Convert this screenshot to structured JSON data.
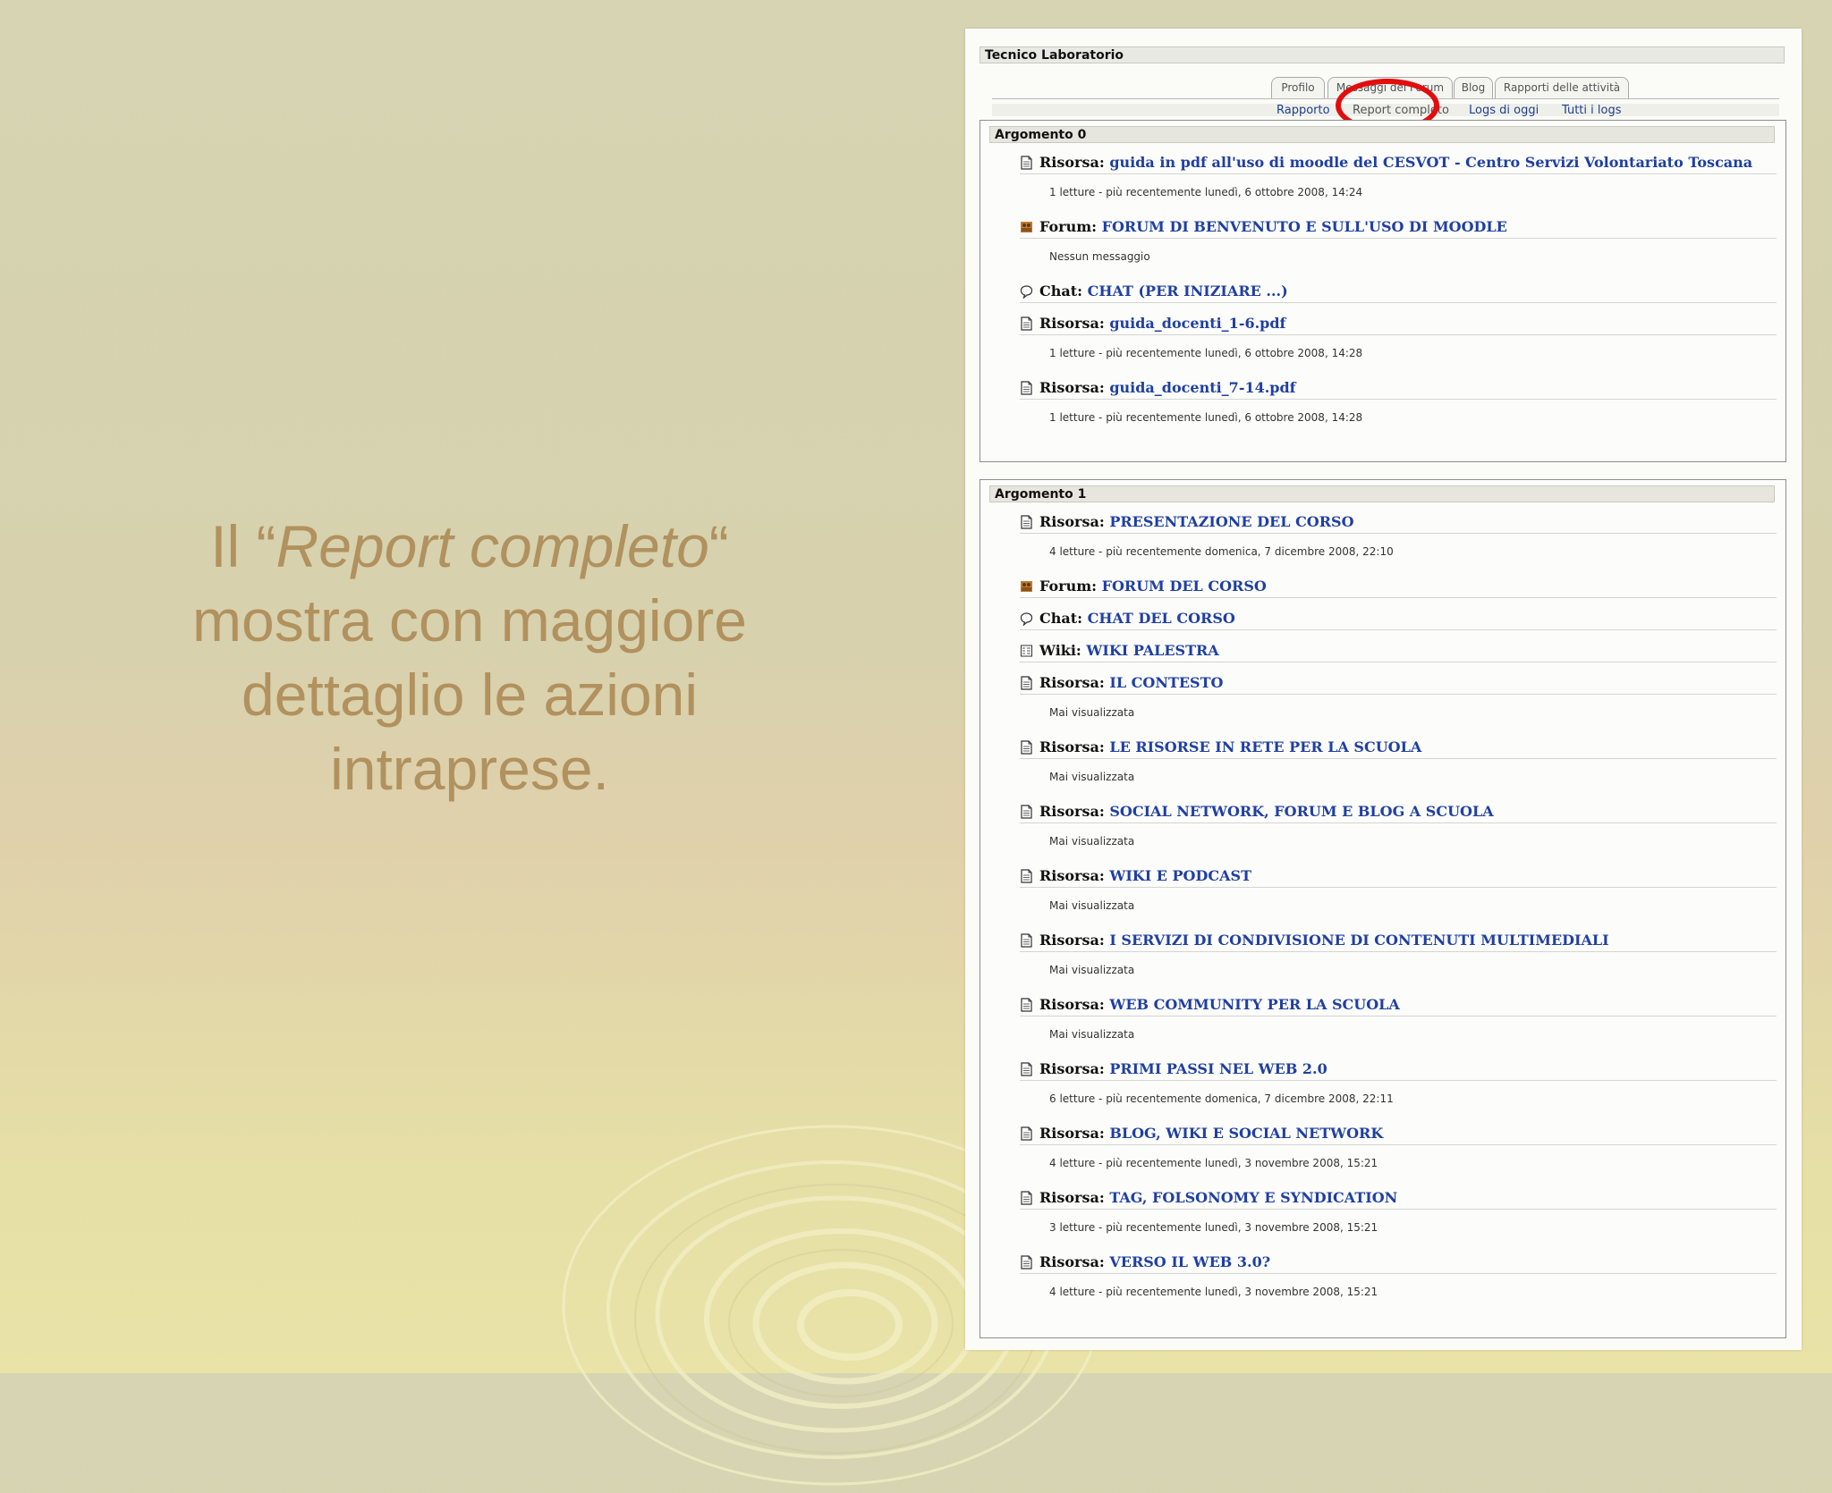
{
  "caption": {
    "line1_pre": "Il “",
    "line1_em": "Report completo",
    "line1_post": "“",
    "line2": "mostra con maggiore",
    "line3": "dettaglio le azioni",
    "line4": "intraprese."
  },
  "course": {
    "title": "Tecnico Laboratorio"
  },
  "tabs": [
    {
      "label": "Profilo"
    },
    {
      "label": "Messaggi del Forum"
    },
    {
      "label": "Blog"
    },
    {
      "label": "Rapporti delle attività"
    }
  ],
  "subtabs": [
    {
      "label": "Rapporto"
    },
    {
      "label": "Report completo",
      "active": true
    },
    {
      "label": "Logs di oggi"
    },
    {
      "label": "Tutti i logs"
    }
  ],
  "colors": {
    "link": "#1f3fa3",
    "highlight_ring": "#e20d0d",
    "caption": "#b1915e"
  },
  "sections": [
    {
      "title": "Argomento 0",
      "items": [
        {
          "icon": "resource-icon",
          "type": "Risorsa:",
          "name": "guida in pdf all'uso di moodle del CESVOT - Centro Servizi Volontariato Toscana",
          "detail": "1 letture - più recentemente lunedì, 6 ottobre 2008, 14:24"
        },
        {
          "icon": "forum-icon",
          "type": "Forum:",
          "name": "FORUM DI BENVENUTO E SULL'USO DI MOODLE",
          "detail": "Nessun messaggio"
        },
        {
          "icon": "chat-icon",
          "type": "Chat:",
          "name": "CHAT (PER INIZIARE ...)",
          "detail": ""
        },
        {
          "icon": "resource-icon",
          "type": "Risorsa:",
          "name": "guida_docenti_1-6.pdf",
          "detail": "1 letture - più recentemente lunedì, 6 ottobre 2008, 14:28"
        },
        {
          "icon": "resource-icon",
          "type": "Risorsa:",
          "name": "guida_docenti_7-14.pdf",
          "detail": "1 letture - più recentemente lunedì, 6 ottobre 2008, 14:28"
        }
      ]
    },
    {
      "title": "Argomento 1",
      "items": [
        {
          "icon": "resource-icon",
          "type": "Risorsa:",
          "name": "PRESENTAZIONE DEL CORSO",
          "detail": "4 letture - più recentemente domenica, 7 dicembre 2008, 22:10"
        },
        {
          "icon": "forum-icon",
          "type": "Forum:",
          "name": "FORUM DEL CORSO",
          "detail": ""
        },
        {
          "icon": "chat-icon",
          "type": "Chat:",
          "name": "CHAT DEL CORSO",
          "detail": ""
        },
        {
          "icon": "wiki-icon",
          "type": "Wiki:",
          "name": "WIKI PALESTRA",
          "detail": ""
        },
        {
          "icon": "resource-icon",
          "type": "Risorsa:",
          "name": "IL CONTESTO",
          "detail": "Mai visualizzata"
        },
        {
          "icon": "resource-icon",
          "type": "Risorsa:",
          "name": "LE RISORSE IN RETE PER LA SCUOLA",
          "detail": "Mai visualizzata"
        },
        {
          "icon": "resource-icon",
          "type": "Risorsa:",
          "name": "SOCIAL NETWORK, FORUM E BLOG A SCUOLA",
          "detail": "Mai visualizzata"
        },
        {
          "icon": "resource-icon",
          "type": "Risorsa:",
          "name": "WIKI E PODCAST",
          "detail": "Mai visualizzata"
        },
        {
          "icon": "resource-icon",
          "type": "Risorsa:",
          "name": "I SERVIZI DI CONDIVISIONE DI CONTENUTI MULTIMEDIALI",
          "detail": "Mai visualizzata"
        },
        {
          "icon": "resource-icon",
          "type": "Risorsa:",
          "name": "WEB COMMUNITY PER LA SCUOLA",
          "detail": "Mai visualizzata"
        },
        {
          "icon": "resource-icon",
          "type": "Risorsa:",
          "name": "PRIMI PASSI NEL WEB 2.0",
          "detail": "6 letture - più recentemente domenica, 7 dicembre 2008, 22:11"
        },
        {
          "icon": "resource-icon",
          "type": "Risorsa:",
          "name": "BLOG, WIKI E SOCIAL NETWORK",
          "detail": "4 letture - più recentemente lunedì, 3 novembre 2008, 15:21"
        },
        {
          "icon": "resource-icon",
          "type": "Risorsa:",
          "name": "TAG, FOLSONOMY E SYNDICATION",
          "detail": "3 letture - più recentemente lunedì, 3 novembre 2008, 15:21"
        },
        {
          "icon": "resource-icon",
          "type": "Risorsa:",
          "name": "VERSO IL WEB 3.0?",
          "detail": "4 letture - più recentemente lunedì, 3 novembre 2008, 15:21"
        }
      ]
    }
  ]
}
